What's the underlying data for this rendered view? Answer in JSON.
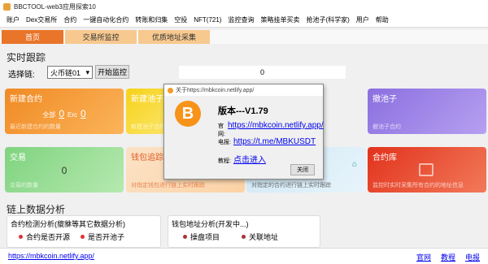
{
  "window": {
    "title": "BBCTOOL-web3应用探索10"
  },
  "menu": [
    "账户",
    "Dex交易所",
    "合约",
    "一键自动化合约",
    "转账和归集",
    "空投",
    "NFT(721)",
    "监控查询",
    "策略挂单买卖",
    "抢池子(科学家)",
    "用户",
    "帮助"
  ],
  "tabs": [
    "首页",
    "交易所监控",
    "优质地址采集"
  ],
  "realtime": {
    "title": "实时跟踪",
    "chain_label": "选择链:",
    "chain_value": "火币链01",
    "start_button": "开始监控",
    "counter": "0"
  },
  "cards": {
    "new_contract": {
      "title": "新建合约",
      "all_label": "全部",
      "all_value": "0",
      "erc_label": "Erc",
      "erc_value": "0",
      "sub": "最近新建合约的数量"
    },
    "new_pool": {
      "title": "新建池子",
      "sub": "新建池子合约"
    },
    "remove_pool": {
      "title": "撤池子",
      "sub": "撤池子合约"
    },
    "trade": {
      "title": "交易",
      "value": "0",
      "sub": "交易的数量"
    },
    "wallet_track": {
      "title": "钱包追踪",
      "sub": "对指定钱包进行链上实时跟踪"
    },
    "contract_track": {
      "sub": "对指定的合约进行链上实时跟踪"
    },
    "contract_lib": {
      "title": "合约库",
      "sub": "监控时实时采集所有合约的地址信息"
    }
  },
  "dialog": {
    "title": "关于https://mbkcoin.netlify.app/",
    "coin_symbol": "B",
    "version": "版本---V1.79",
    "site_label": "官网:",
    "site_link": "https://mbkcoin.netlify.app/",
    "tg_label": "电报:",
    "tg_link": "https://t.me/MBKUSDT",
    "tutorial_label": "教程:",
    "tutorial_link": "点击进入",
    "close_button": "关闭"
  },
  "analysis": {
    "title": "链上数据分析",
    "panel1_title": "合约检测分析(貔貅等其它数据分析)",
    "panel1_items": [
      "合约是否开源",
      "是否开池子"
    ],
    "panel2_title": "钱包地址分析(开发中...)",
    "panel2_items": [
      "操盘项目",
      "关联地址"
    ]
  },
  "status": {
    "link": "https://mbkcoin.netlify.app/",
    "right": [
      "官网",
      "教程",
      "电报"
    ]
  },
  "colors": {
    "accent": "#e8752a",
    "link": "#0000ee"
  }
}
